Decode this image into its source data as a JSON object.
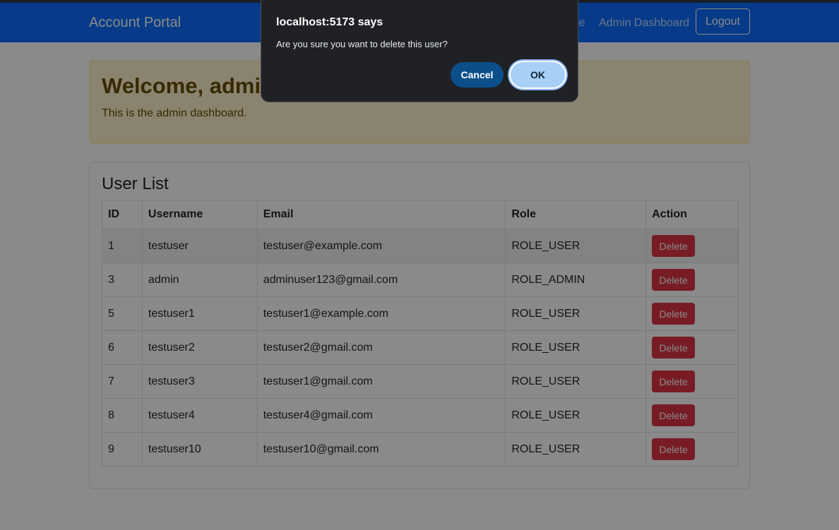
{
  "navbar": {
    "brand": "Account Portal",
    "profile_link_fragment": "le",
    "admin_link": "Admin Dashboard",
    "logout_label": "Logout",
    "color": "#0d6efd"
  },
  "alert": {
    "heading": "Welcome, admin",
    "text": "This is the admin dashboard."
  },
  "user_list": {
    "title": "User List",
    "columns": [
      "ID",
      "Username",
      "Email",
      "Role",
      "Action"
    ],
    "rows": [
      {
        "id": "1",
        "username": "testuser",
        "email": "testuser@example.com",
        "role": "ROLE_USER",
        "action": "Delete"
      },
      {
        "id": "3",
        "username": "admin",
        "email": "adminuser123@gmail.com",
        "role": "ROLE_ADMIN",
        "action": "Delete"
      },
      {
        "id": "5",
        "username": "testuser1",
        "email": "testuser1@example.com",
        "role": "ROLE_USER",
        "action": "Delete"
      },
      {
        "id": "6",
        "username": "testuser2",
        "email": "testuser2@gmail.com",
        "role": "ROLE_USER",
        "action": "Delete"
      },
      {
        "id": "7",
        "username": "testuser3",
        "email": "testuser1@gmail.com",
        "role": "ROLE_USER",
        "action": "Delete"
      },
      {
        "id": "8",
        "username": "testuser4",
        "email": "testuser4@gmail.com",
        "role": "ROLE_USER",
        "action": "Delete"
      },
      {
        "id": "9",
        "username": "testuser10",
        "email": "testuser10@gmail.com",
        "role": "ROLE_USER",
        "action": "Delete"
      }
    ],
    "delete_color": "#dc3545"
  },
  "dialog": {
    "title": "localhost:5173 says",
    "message": "Are you sure you want to delete this user?",
    "cancel_label": "Cancel",
    "ok_label": "OK"
  }
}
